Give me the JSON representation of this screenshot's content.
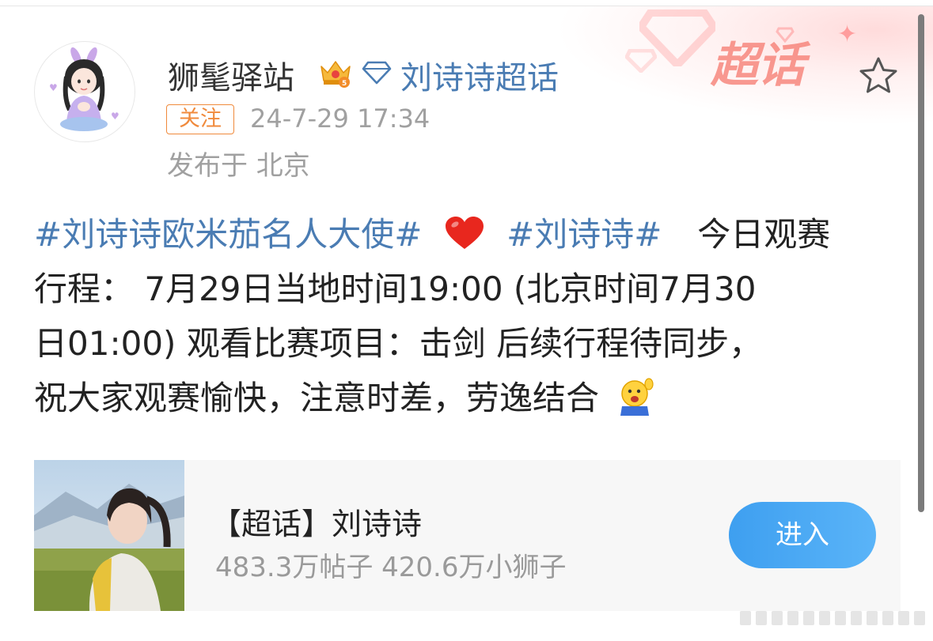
{
  "banner": {
    "label": "超话"
  },
  "header": {
    "username": "狮髦驿站",
    "topic_link": "刘诗诗超话",
    "follow_label": "关注",
    "timestamp": "24-7-29 17:34",
    "location": "发布于 北京"
  },
  "post": {
    "lines": [
      {
        "hashtag1": "#刘诗诗欧米茄名人大使#",
        "hashtag2": "#刘诗诗#",
        "text": "今日观赛"
      },
      {
        "text": "行程： 7月29日当地时间19:00 (北京时间7月30"
      },
      {
        "text": "日01:00) 观看比赛项目：击剑  后续行程待同步，"
      },
      {
        "text": "祝大家观赛愉快，注意时差，劳逸结合"
      }
    ]
  },
  "card": {
    "title": "【超话】刘诗诗",
    "stats": "483.3万帖子 420.6万小狮子",
    "enter_label": "进入"
  },
  "colors": {
    "link_blue": "#4a7cb3",
    "follow_orange": "#f08a3c",
    "button_blue": "#3e9ff0"
  },
  "icons": {
    "star": "star-outline-icon",
    "crown": "crown-badge-icon",
    "diamond": "diamond-icon",
    "heart": "red-heart-icon",
    "emoji": "raising-hand-emoji-icon"
  }
}
